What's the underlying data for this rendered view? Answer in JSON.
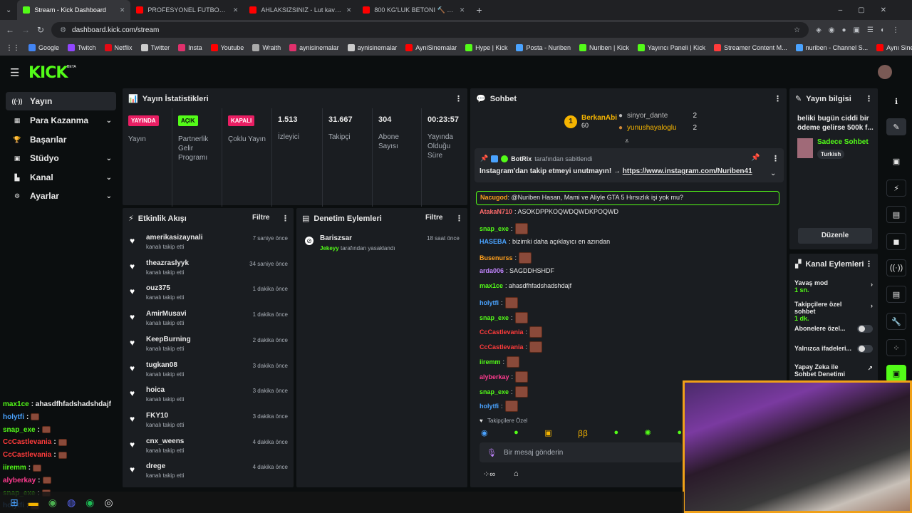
{
  "browser": {
    "tabs": [
      {
        "title": "Stream - Kick Dashboard",
        "color": "#53fc18",
        "active": true
      },
      {
        "title": "PROFESYONEL FUTBOLCU SEN",
        "color": "#ff0000",
        "active": false
      },
      {
        "title": "AHLAKSIZSINIZ - Lut kavminde",
        "color": "#ff0000",
        "active": false
      },
      {
        "title": "800 KG'LUK BETONI 🔨 KIRAR M",
        "color": "#ff0000",
        "active": false
      }
    ],
    "url": "dashboard.kick.com/stream",
    "bookmarks": [
      "Google",
      "Twitch",
      "Netflix",
      "Twitter",
      "Insta",
      "Youtube",
      "Wraith",
      "aynisinemalar",
      "aynisinemalar",
      "AyniSinemalar",
      "Hype | Kick",
      "Posta - Nuriben",
      "Nuriben | Kick",
      "Yayıncı Paneli | Kick",
      "Streamer Content M...",
      "nuriben - Channel S...",
      "Aynı Sinemalar - Ça..."
    ]
  },
  "kick": {
    "logo": "KICK",
    "beta": "BETA"
  },
  "sidebar": {
    "items": [
      {
        "label": "Yayın",
        "icon": "broadcast-icon",
        "glyph": "((·))",
        "chev": false
      },
      {
        "label": "Para Kazanma",
        "icon": "money-icon",
        "glyph": "▦",
        "chev": true
      },
      {
        "label": "Başarılar",
        "icon": "trophy-icon",
        "glyph": "🏆",
        "chev": false
      },
      {
        "label": "Stüdyo",
        "icon": "studio-icon",
        "glyph": "▣",
        "chev": true
      },
      {
        "label": "Kanal",
        "icon": "channel-icon",
        "glyph": "▙",
        "chev": true
      },
      {
        "label": "Ayarlar",
        "icon": "settings-icon",
        "glyph": "⚙",
        "chev": true
      }
    ]
  },
  "stats": {
    "title": "Yayın İstatistikleri",
    "cols": [
      {
        "badge": "YAYINDA",
        "badge_color": "#e91e63",
        "label": "Yayın"
      },
      {
        "badge": "AÇIK",
        "badge_color": "#53fc18",
        "label": "Partnerlik Gelir Programı"
      },
      {
        "badge": "KAPALI",
        "badge_color": "#e91e63",
        "label": "Çoklu Yayın"
      },
      {
        "num": "1.513",
        "label": "İzleyici"
      },
      {
        "num": "31.667",
        "label": "Takipçi"
      },
      {
        "num": "304",
        "label": "Abone Sayısı"
      },
      {
        "num": "00:23:57",
        "label": "Yayında Olduğu Süre"
      }
    ]
  },
  "activity": {
    "title": "Etkinlik Akışı",
    "filter": "Filtre",
    "events": [
      {
        "name": "amerikasizaynali",
        "sub": "kanalı takip etti",
        "time": "7 saniye önce"
      },
      {
        "name": "theazraslyyk",
        "sub": "kanalı takip etti",
        "time": "34 saniye önce"
      },
      {
        "name": "ouz375",
        "sub": "kanalı takip etti",
        "time": "1 dakika önce"
      },
      {
        "name": "AmirMusavi",
        "sub": "kanalı takip etti",
        "time": "1 dakika önce"
      },
      {
        "name": "KeepBurning",
        "sub": "kanalı takip etti",
        "time": "2 dakika önce"
      },
      {
        "name": "tugkan08",
        "sub": "kanalı takip etti",
        "time": "3 dakika önce"
      },
      {
        "name": "hoica",
        "sub": "kanalı takip etti",
        "time": "3 dakika önce"
      },
      {
        "name": "FKY10",
        "sub": "kanalı takip etti",
        "time": "3 dakika önce"
      },
      {
        "name": "cnx_weens",
        "sub": "kanalı takip etti",
        "time": "4 dakika önce"
      },
      {
        "name": "drege",
        "sub": "kanalı takip etti",
        "time": "4 dakika önce"
      }
    ]
  },
  "moderation": {
    "title": "Denetim Eylemleri",
    "filter": "Filtre",
    "item": {
      "name": "Bariszsar",
      "by": "Jekeyy",
      "action": "tarafından yasaklandı",
      "time": "18 saat önce"
    }
  },
  "chat": {
    "title": "Sohbet",
    "top": {
      "name": "BerkanAbi",
      "count": "60"
    },
    "leaders": [
      {
        "name": "sinyor_dante",
        "count": "2"
      },
      {
        "name": "yunushayaloglu",
        "count": "2"
      }
    ],
    "pinned": {
      "user": "BotRix",
      "by": "tarafından sabitlendi",
      "text": "Instagram'dan takip etmeyi unutmayın! →",
      "link": "https://www.instagram.com/Nuriben41"
    },
    "highlight": {
      "user": "Nacugod",
      "text": ": @Nuriben Hasan, Mami ve Aliyle GTA 5 Hırsızlık işi yok mu?"
    },
    "messages": [
      {
        "user": "AtakaN710",
        "color": "#ff6b6b",
        "text": ": ASOKDPPKOQWDQWDKPOQWD",
        "emote": false
      },
      {
        "user": "snap_exe",
        "color": "#53fc18",
        "text": ":",
        "emote": true
      },
      {
        "user": "HASEBA",
        "color": "#4aa3ff",
        "text": ": bizimki daha açıklayıcı en azından",
        "emote": false
      },
      {
        "user": "Busenurss",
        "color": "#ff9f1c",
        "text": ":",
        "emote": true
      },
      {
        "user": "arda006",
        "color": "#c084fc",
        "text": ": SAGDDHSHDF",
        "emote": false
      },
      {
        "user": "max1ce",
        "color": "#53fc18",
        "text": ": ahasdfhfadshadshdajf",
        "emote": false
      },
      {
        "user": "holytfi",
        "color": "#4aa3ff",
        "text": ":",
        "emote": true
      },
      {
        "user": "snap_exe",
        "color": "#53fc18",
        "text": ":",
        "emote": true
      },
      {
        "user": "CcCastlevania",
        "color": "#ff3b3b",
        "text": ":",
        "emote": true
      },
      {
        "user": "CcCastlevania",
        "color": "#ff3b3b",
        "text": ":",
        "emote": true
      },
      {
        "user": "iiremm",
        "color": "#53fc18",
        "text": ":",
        "emote": true
      },
      {
        "user": "alyberkay",
        "color": "#ff3b8f",
        "text": ":",
        "emote": true
      },
      {
        "user": "snap_exe",
        "color": "#53fc18",
        "text": ":",
        "emote": true
      },
      {
        "user": "holytfi",
        "color": "#4aa3ff",
        "text": ":",
        "emote": true
      }
    ],
    "mode_label": "Takipçilere Özel",
    "input_placeholder": "Bir mesaj gönderin"
  },
  "stream_info": {
    "title": "Yayın bilgisi",
    "stream_title": "beliki bugün ciddi bir ödeme gelirse 500k f...",
    "category": "Sadece Sohbet",
    "tag": "Turkish",
    "edit": "Düzenle"
  },
  "channel_actions": {
    "title": "Kanal Eylemleri",
    "items": [
      {
        "label": "Yavaş mod",
        "value": "1 sn."
      },
      {
        "label": "Takipçilere özel sohbet",
        "value": "1 dk."
      },
      {
        "label": "Abonelere özel...",
        "value": ""
      },
      {
        "label": "Yalnızca ifadeleri...",
        "value": ""
      },
      {
        "label": "Yapay Zeka ile Sohbet Denetimi",
        "value": ""
      }
    ]
  },
  "overlay_chat": [
    {
      "user": "max1ce",
      "color": "#53fc18",
      "text": ": ahasdfhfadshadshdajf"
    },
    {
      "user": "holytfi",
      "color": "#4aa3ff",
      "text": ":"
    },
    {
      "user": "snap_exe",
      "color": "#53fc18",
      "text": ":"
    },
    {
      "user": "CcCastlevania",
      "color": "#ff3b3b",
      "text": ":"
    },
    {
      "user": "CcCastlevania",
      "color": "#ff3b3b",
      "text": ":"
    },
    {
      "user": "iiremm",
      "color": "#53fc18",
      "text": ":"
    },
    {
      "user": "alyberkay",
      "color": "#ff3b8f",
      "text": ":"
    },
    {
      "user": "snap_exe",
      "color": "#53fc18",
      "text": ":"
    },
    {
      "user": "holytfi",
      "color": "#4aa3ff",
      "text": ":"
    }
  ],
  "colors": {
    "accent": "#53fc18",
    "live": "#e91e63",
    "bg": "#0b0e0f",
    "panel": "#1a1d21"
  }
}
